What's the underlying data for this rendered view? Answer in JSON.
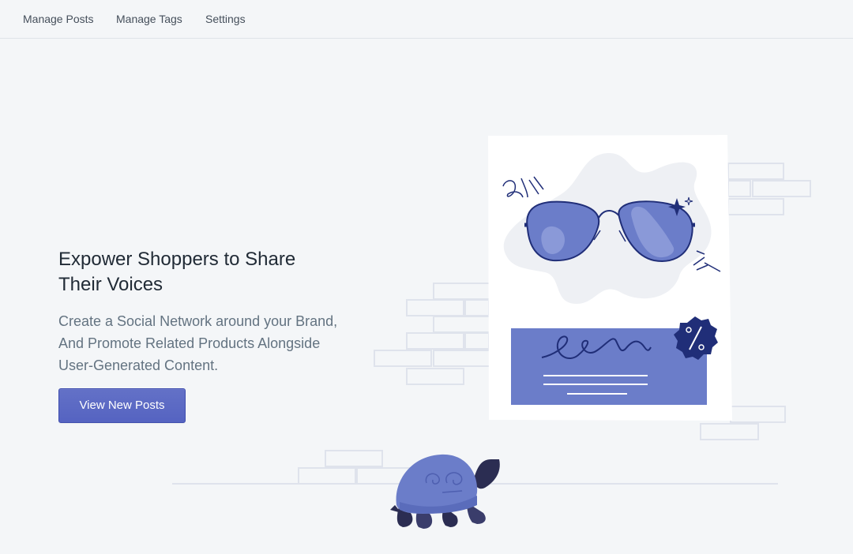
{
  "nav": {
    "items": [
      {
        "label": "Manage Posts"
      },
      {
        "label": "Manage Tags"
      },
      {
        "label": "Settings"
      }
    ]
  },
  "hero": {
    "title": "Expower Shoppers to Share Their Voices",
    "subtitle": "Create a Social Network around your Brand, And Promote Related Products Alongside User-Generated Content.",
    "cta_label": "View New Posts"
  },
  "colors": {
    "accent": "#5c6ac4",
    "background": "#f4f6f8",
    "heading": "#212b36",
    "body_text": "#637381",
    "navy": "#202e78"
  },
  "icons": {
    "sunglasses": "sunglasses-illustration",
    "badge": "percent-badge-icon",
    "turtle": "turtle-illustration"
  }
}
